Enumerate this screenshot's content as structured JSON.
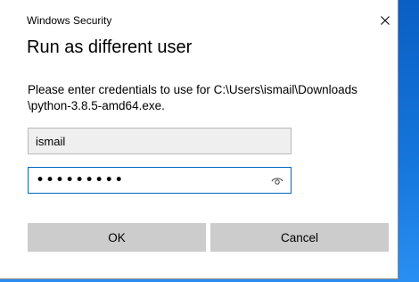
{
  "dialog": {
    "window_title": "Windows Security",
    "heading": "Run as different user",
    "message": "Please enter credentials to use for C:\\Users\\ismail\\Downloads\\python-3.8.5-amd64.exe.",
    "message_line1": "Please enter credentials to use for C:\\Users\\ismail\\Downloads",
    "message_line2": "\\python-3.8.5-amd64.exe."
  },
  "fields": {
    "username_value": "ismail",
    "password_value": "•••••••••"
  },
  "buttons": {
    "ok_label": "OK",
    "cancel_label": "Cancel"
  },
  "icons": {
    "close": "close-icon",
    "reveal": "eye-icon"
  },
  "colors": {
    "accent": "#0067c0",
    "desktop": "#1a7ae0",
    "button_bg": "#cccccc",
    "username_bg": "#efefef"
  }
}
